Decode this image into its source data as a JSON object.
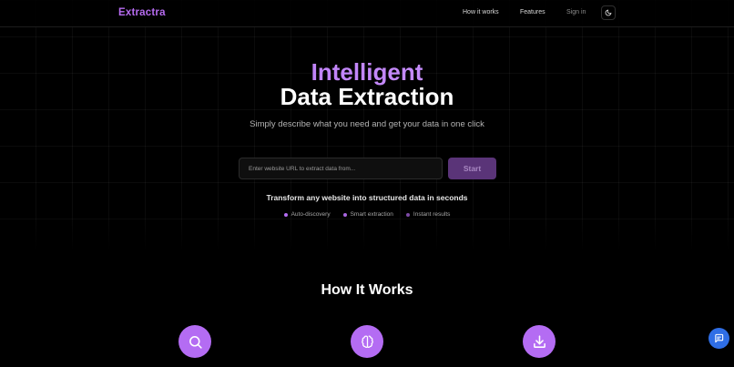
{
  "nav": {
    "logo": "Extractra",
    "links": [
      "How it works",
      "Features",
      "Sign in"
    ],
    "theme_icon": "moon-icon"
  },
  "hero": {
    "title_line1": "Intelligent",
    "title_line2": "Data Extraction",
    "subtitle": "Simply describe what you need and get your data in one click",
    "search": {
      "placeholder": "Enter website URL to extract data from...",
      "value": ""
    },
    "start_label": "Start",
    "tagline": "Transform any website into structured data in seconds",
    "features": [
      {
        "label": "Auto-discovery",
        "color": "#b46cf3"
      },
      {
        "label": "Smart extraction",
        "color": "#a865e0"
      },
      {
        "label": "Instant results",
        "color": "#7d4aa6"
      }
    ]
  },
  "how_it_works": {
    "title": "How It Works",
    "steps": [
      {
        "icon": "search-icon",
        "color": "#b46cf3"
      },
      {
        "icon": "brain-icon",
        "color": "#b46cf3"
      },
      {
        "icon": "download-icon",
        "color": "#b46cf3"
      }
    ]
  },
  "chat": {
    "icon": "chat-icon",
    "color": "#2f6ee6"
  },
  "colors": {
    "accent": "#b46cf3",
    "background": "#000000",
    "start_button": "#5a3478"
  }
}
